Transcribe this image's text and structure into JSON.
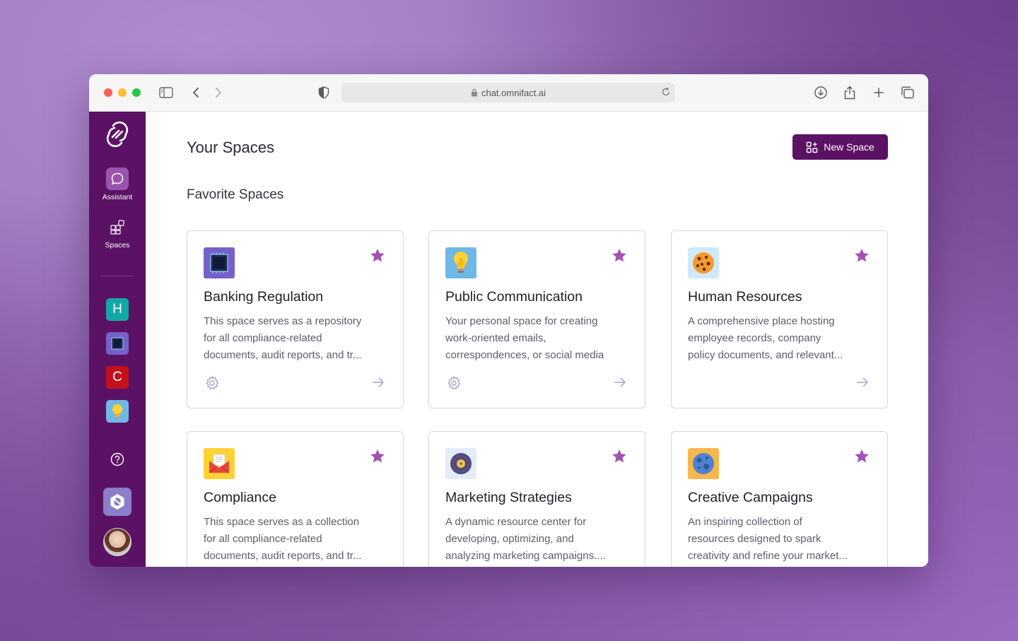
{
  "browser": {
    "url": "chat.omnifact.ai"
  },
  "sidebar": {
    "nav": [
      {
        "label": "Assistant",
        "icon": "chat-bubble-icon",
        "active": true
      },
      {
        "label": "Spaces",
        "icon": "spaces-grid-icon",
        "active": false
      }
    ],
    "spaces": [
      {
        "letter": "H",
        "color": "#13a8a8"
      },
      {
        "icon": "chip-icon",
        "color": "#7561c8"
      },
      {
        "letter": "C",
        "color": "#c4101a"
      },
      {
        "icon": "lightbulb-icon",
        "color": "#6fb8e6"
      }
    ]
  },
  "main": {
    "title": "Your Spaces",
    "new_space_label": "New Space",
    "favorites_title": "Favorite Spaces",
    "cards": [
      {
        "name": "Banking Regulation",
        "icon": "chip-icon",
        "lines": [
          "This space serves as a repository",
          "for all compliance-related",
          "documents, audit reports, and tr..."
        ],
        "favorite": true,
        "has_settings": true
      },
      {
        "name": "Public Communication",
        "icon": "lightbulb-icon",
        "lines": [
          "Your personal space for creating",
          "work-oriented emails,",
          "correspondences, or social media"
        ],
        "favorite": true,
        "has_settings": true
      },
      {
        "name": "Human Resources",
        "icon": "cookie-icon",
        "lines": [
          "A comprehensive place hosting",
          "employee records, company",
          "policy documents, and relevant..."
        ],
        "favorite": true,
        "has_settings": false
      },
      {
        "name": "Compliance",
        "icon": "mail-icon",
        "lines": [
          "This space serves as a collection",
          "for all compliance-related",
          "documents, audit reports, and tr..."
        ],
        "favorite": true,
        "has_settings": true
      },
      {
        "name": "Marketing Strategies",
        "icon": "vinyl-icon",
        "lines": [
          "A dynamic resource center for",
          "developing, optimizing, and",
          "analyzing marketing campaigns...."
        ],
        "favorite": true,
        "has_settings": true
      },
      {
        "name": "Creative Campaigns",
        "icon": "moon-icon",
        "lines": [
          "An inspiring collection of",
          "resources designed to spark",
          "creativity and refine your market..."
        ],
        "favorite": true,
        "has_settings": false
      }
    ]
  },
  "colors": {
    "brand": "#5c1264",
    "star": "#a352b4"
  }
}
